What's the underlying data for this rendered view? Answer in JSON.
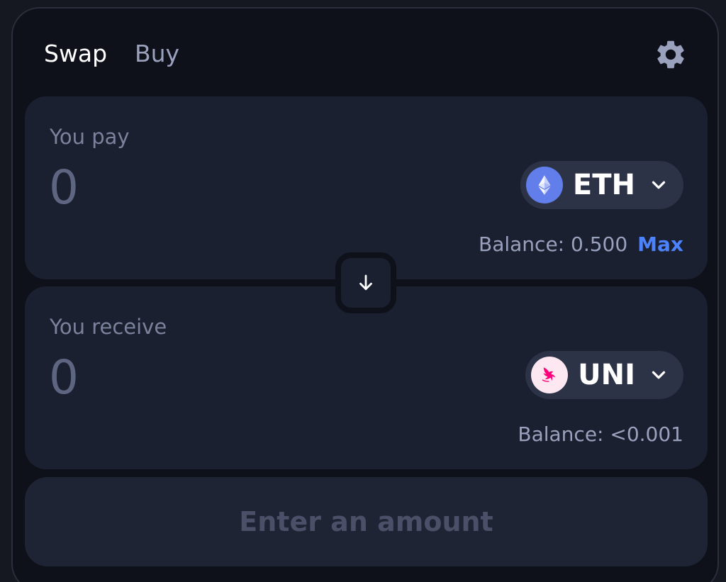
{
  "tabs": {
    "swap_label": "Swap",
    "buy_label": "Buy"
  },
  "icons": {
    "settings": "gear-icon",
    "switch": "arrow-down-icon",
    "token_dropdown": "chevron-down-icon"
  },
  "pay": {
    "label": "You pay",
    "amount_placeholder": "0",
    "token_symbol": "ETH",
    "balance_label": "Balance: 0.500",
    "max_label": "Max"
  },
  "receive": {
    "label": "You receive",
    "amount_placeholder": "0",
    "token_symbol": "UNI",
    "balance_label": "Balance: <0.001"
  },
  "action": {
    "label": "Enter an amount"
  },
  "colors": {
    "background": "#0e111a",
    "panel": "#1b2030",
    "accent_blue": "#4c82fb",
    "eth_brand": "#627eea",
    "uni_brand": "#ff007a"
  }
}
